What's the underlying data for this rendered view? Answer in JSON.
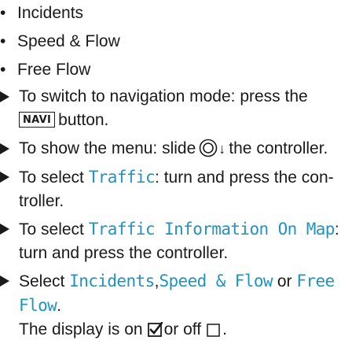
{
  "bullets": [
    "Incidents",
    "Speed & Flow",
    "Free Flow"
  ],
  "steps": {
    "s1": {
      "line1": "To switch to navigation mode: press the",
      "key": "NAVI",
      "line2_after_key": "button."
    },
    "s2": {
      "before": "To show the menu: slide",
      "after": "the controller."
    },
    "s3": {
      "before": "To select",
      "ui": "Traffic",
      "after": ": turn and press the con-",
      "line2": "troller."
    },
    "s4": {
      "before": "To select",
      "ui": "Traffic Information On Map",
      "after": ":",
      "line2": "turn and press the controller."
    },
    "s5": {
      "before": "Select",
      "ui1": "Incidents",
      "sep": ",",
      "ui2": "Speed & Flow",
      "or": "or",
      "ui3_line1": "Free",
      "ui3_line2": "Flow",
      "end": ".",
      "status_before": "The display is on",
      "status_mid": "or off",
      "status_end": "."
    }
  },
  "icons": {
    "bullet": "bullet-dot",
    "step_marker": "triangle-right-icon",
    "controller": "controller-icon",
    "checked": "checkbox-checked-icon",
    "unchecked": "checkbox-unchecked-icon"
  },
  "colors": {
    "text": "#1a1a1a",
    "ui_term": "#1f93c2"
  }
}
